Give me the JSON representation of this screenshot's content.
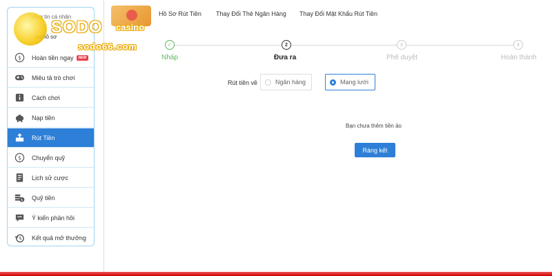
{
  "logo": {
    "brand": "SODO",
    "casino": "casino",
    "url": "sodo66.com"
  },
  "header": {
    "profile_partial": "hông tin cá nhân",
    "edit_partial": "ửa hồ sơ"
  },
  "sidebar": {
    "items": [
      {
        "label": "Hoàn tiền ngay",
        "badge": "NEW",
        "icon": "cashback-icon"
      },
      {
        "label": "Miêu tả trò chơi",
        "icon": "gamepad-icon"
      },
      {
        "label": "Cách chơi",
        "icon": "info-icon"
      },
      {
        "label": "Nạp tiền",
        "icon": "piggy-bank-icon"
      },
      {
        "label": "Rút Tiền",
        "icon": "withdraw-icon",
        "active": true
      },
      {
        "label": "Chuyển quỹ",
        "icon": "transfer-icon"
      },
      {
        "label": "Lịch sử cược",
        "icon": "history-doc-icon"
      },
      {
        "label": "Quỹ tiền",
        "icon": "coins-icon"
      },
      {
        "label": "Ý kiến phản hồi",
        "icon": "chat-icon"
      },
      {
        "label": "Kết quả mở thưởng",
        "icon": "clock-history-icon"
      }
    ]
  },
  "tabs": [
    {
      "label": "Hồ Sơ Rút Tiền"
    },
    {
      "label": "Thay Đổi Thẻ Ngân Hàng"
    },
    {
      "label": "Thay Đổi Mật Khẩu Rút Tiền"
    }
  ],
  "steps": [
    {
      "num": "✓",
      "label": "Nháp",
      "state": "done"
    },
    {
      "num": "2",
      "label": "Đưa ra",
      "state": "current"
    },
    {
      "num": "3",
      "label": "Phê duyệt",
      "state": "pending"
    },
    {
      "num": "4",
      "label": "Hoàn thành",
      "state": "pending"
    }
  ],
  "withdraw": {
    "label": "Rút tiền về",
    "options": [
      {
        "label": "Ngân hàng",
        "selected": false
      },
      {
        "label": "Mạng lưới",
        "selected": true
      }
    ]
  },
  "notice": "Bạn chưa thêm tiền ảo",
  "bind_button": "Ràng kết",
  "colors": {
    "accent": "#2d7fd7",
    "done": "#5cb85c",
    "badge": "#e8414b",
    "bottom_bar": "#d11"
  }
}
